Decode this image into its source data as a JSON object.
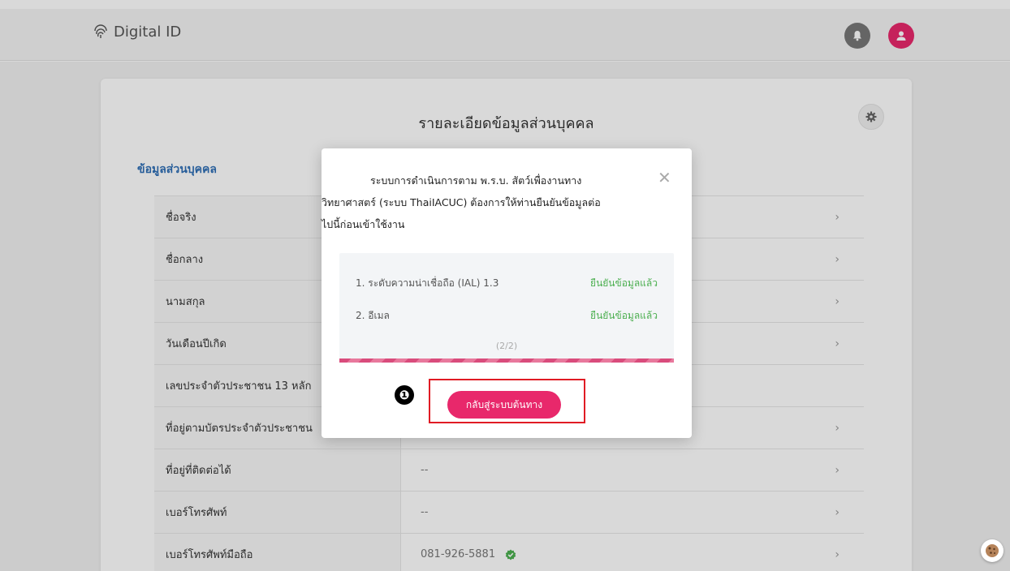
{
  "header": {
    "brand_name": "Digital ID",
    "icons": [
      "fingerprint-icon",
      "bell-icon",
      "user-icon"
    ],
    "accent_color": "#e8286b"
  },
  "card": {
    "title": "รายละเอียดข้อมูลส่วนบุคคล",
    "section_title": "ข้อมูลส่วนบุคคล",
    "rows": [
      {
        "label": "ชื่อจริง",
        "value": ""
      },
      {
        "label": "ชื่อกลาง",
        "value": ""
      },
      {
        "label": "นามสกุล",
        "value": ""
      },
      {
        "label": "วันเดือนปีเกิด",
        "value": ""
      },
      {
        "label": "เลขประจำตัวประชาชน 13 หลัก",
        "value": ""
      },
      {
        "label": "ที่อยู่ตามบัตรประจำตัวประชาชน",
        "value": ""
      },
      {
        "label": "ที่อยู่ที่ติดต่อได้",
        "value": "--"
      },
      {
        "label": "เบอร์โทรศัพท์",
        "value": "--"
      },
      {
        "label": "เบอร์โทรศัพท์มือถือ",
        "value": "081-926-5881"
      }
    ]
  },
  "modal": {
    "message_line1": "ระบบการดำเนินการตาม พ.ร.บ. สัตว์เพื่องานทาง",
    "message_line2": "วิทยาศาสตร์ (ระบบ ThaiIACUC) ต้องการให้ท่านยืนยันข้อมูลต่อ",
    "message_line3": "ไปนี้ก่อนเข้าใช้งาน",
    "steps": [
      {
        "label": "1. ระดับความน่าเชื่อถือ (IAL) 1.3",
        "status": "ยืนยันข้อมูลแล้ว"
      },
      {
        "label": "2. อีเมล",
        "status": "ยืนยันข้อมูลแล้ว"
      }
    ],
    "counter": "(2/2)",
    "progress": 1.0,
    "button_label": "กลับสู่ระบบต้นทาง"
  },
  "annotation": {
    "marker": "❶"
  }
}
